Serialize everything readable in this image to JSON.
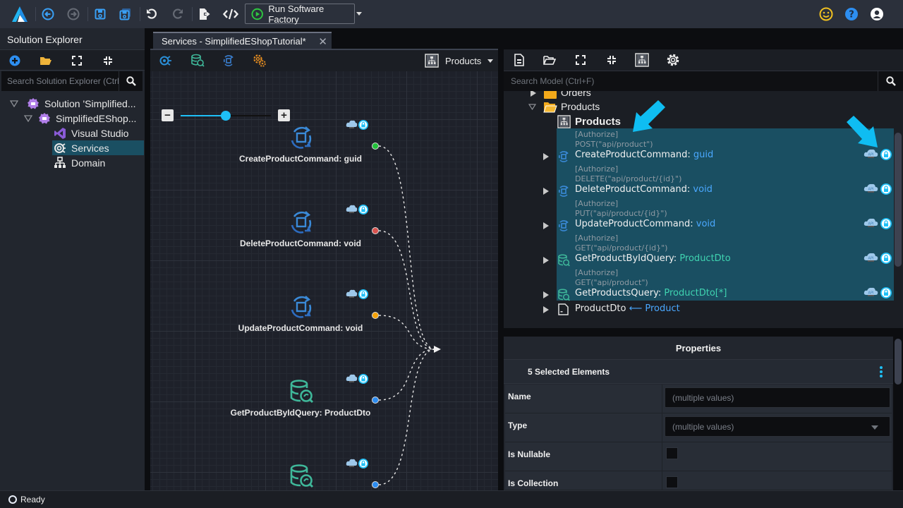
{
  "toolbar": {
    "run_label": "Run Software Factory",
    "icons": [
      "app-logo-icon",
      "navigate-back-icon",
      "navigate-forward-icon",
      "save-icon",
      "save-all-icon",
      "undo-icon",
      "redo-icon",
      "export-icon",
      "code-icon",
      "play-icon",
      "smiley-feedback-icon",
      "help-icon",
      "user-account-icon"
    ]
  },
  "solution_explorer": {
    "title": "Solution Explorer",
    "search_placeholder": "Search Solution Explorer (Ctrl",
    "tools": [
      "add-icon",
      "open-folder-icon",
      "expand-all-icon",
      "collapse-all-icon"
    ],
    "tree": [
      {
        "label": "Solution 'Simplified...",
        "level": 0,
        "expanded": true
      },
      {
        "label": "SimplifiedEShop...",
        "level": 1,
        "expanded": true
      },
      {
        "label": "Visual Studio",
        "level": 2
      },
      {
        "label": "Services",
        "level": 2,
        "selected": true
      },
      {
        "label": "Domain",
        "level": 2
      }
    ]
  },
  "designer": {
    "tab_label": "Services - SimplifiedEShopTutorial*",
    "diagram_name": "Products",
    "tools": [
      "service-icon",
      "query-icon",
      "command-icon",
      "settings-gears-icon"
    ],
    "zoom_level": 0.5,
    "nodes": [
      {
        "label": "CreateProductCommand: guid",
        "kind": "command",
        "port_color": "#22c03a"
      },
      {
        "label": "DeleteProductCommand: void",
        "kind": "command",
        "port_color": "#d9534f"
      },
      {
        "label": "UpdateProductCommand: void",
        "kind": "command",
        "port_color": "#f5a20a"
      },
      {
        "label": "GetProductByIdQuery: ProductDto",
        "kind": "query",
        "port_color": "#2d8cf0"
      },
      {
        "label": "",
        "kind": "query",
        "port_color": "#2d8cf0"
      }
    ]
  },
  "model": {
    "search_placeholder": "Search Model (Ctrl+F)",
    "tools": [
      "new-file-icon",
      "open-folder-icon",
      "expand-all-icon",
      "collapse-all-icon",
      "diagram-icon",
      "settings-icon"
    ],
    "folders": [
      {
        "label": "Orders"
      },
      {
        "label": "Products"
      }
    ],
    "diagram_item": "Products",
    "operations": [
      {
        "attr1": "[Authorize]",
        "attr2": "POST(\"api/product\")",
        "name": "CreateProductCommand:",
        "type": "guid",
        "kind": "command"
      },
      {
        "attr1": "[Authorize]",
        "attr2": "DELETE(\"api/product/{id}\")",
        "name": "DeleteProductCommand:",
        "type": "void",
        "kind": "command"
      },
      {
        "attr1": "[Authorize]",
        "attr2": "PUT(\"api/product/{id}\")",
        "name": "UpdateProductCommand:",
        "type": "void",
        "kind": "command"
      },
      {
        "attr1": "[Authorize]",
        "attr2": "GET(\"api/product/{id}\")",
        "name": "GetProductByIdQuery:",
        "type": "ProductDto",
        "kind": "query"
      },
      {
        "attr1": "[Authorize]",
        "attr2": "GET(\"api/product\")",
        "name": "GetProductsQuery:",
        "type": "ProductDto[*]",
        "kind": "query"
      }
    ],
    "dto": {
      "name": "ProductDto",
      "mapped_from": "Product"
    }
  },
  "properties": {
    "title": "Properties",
    "selection": "5 Selected Elements",
    "rows": [
      {
        "label": "Name",
        "kind": "text",
        "value": "(multiple values)"
      },
      {
        "label": "Type",
        "kind": "select",
        "value": "(multiple values)"
      },
      {
        "label": "Is Nullable",
        "kind": "checkbox",
        "checked": false
      },
      {
        "label": "Is Collection",
        "kind": "checkbox",
        "checked": false
      }
    ]
  },
  "status": {
    "text": "Ready"
  },
  "colors": {
    "accent": "#1ec0f7",
    "selection": "#1a4f62",
    "type_blue": "#4aa8ff",
    "type_green": "#3fd3b0"
  }
}
